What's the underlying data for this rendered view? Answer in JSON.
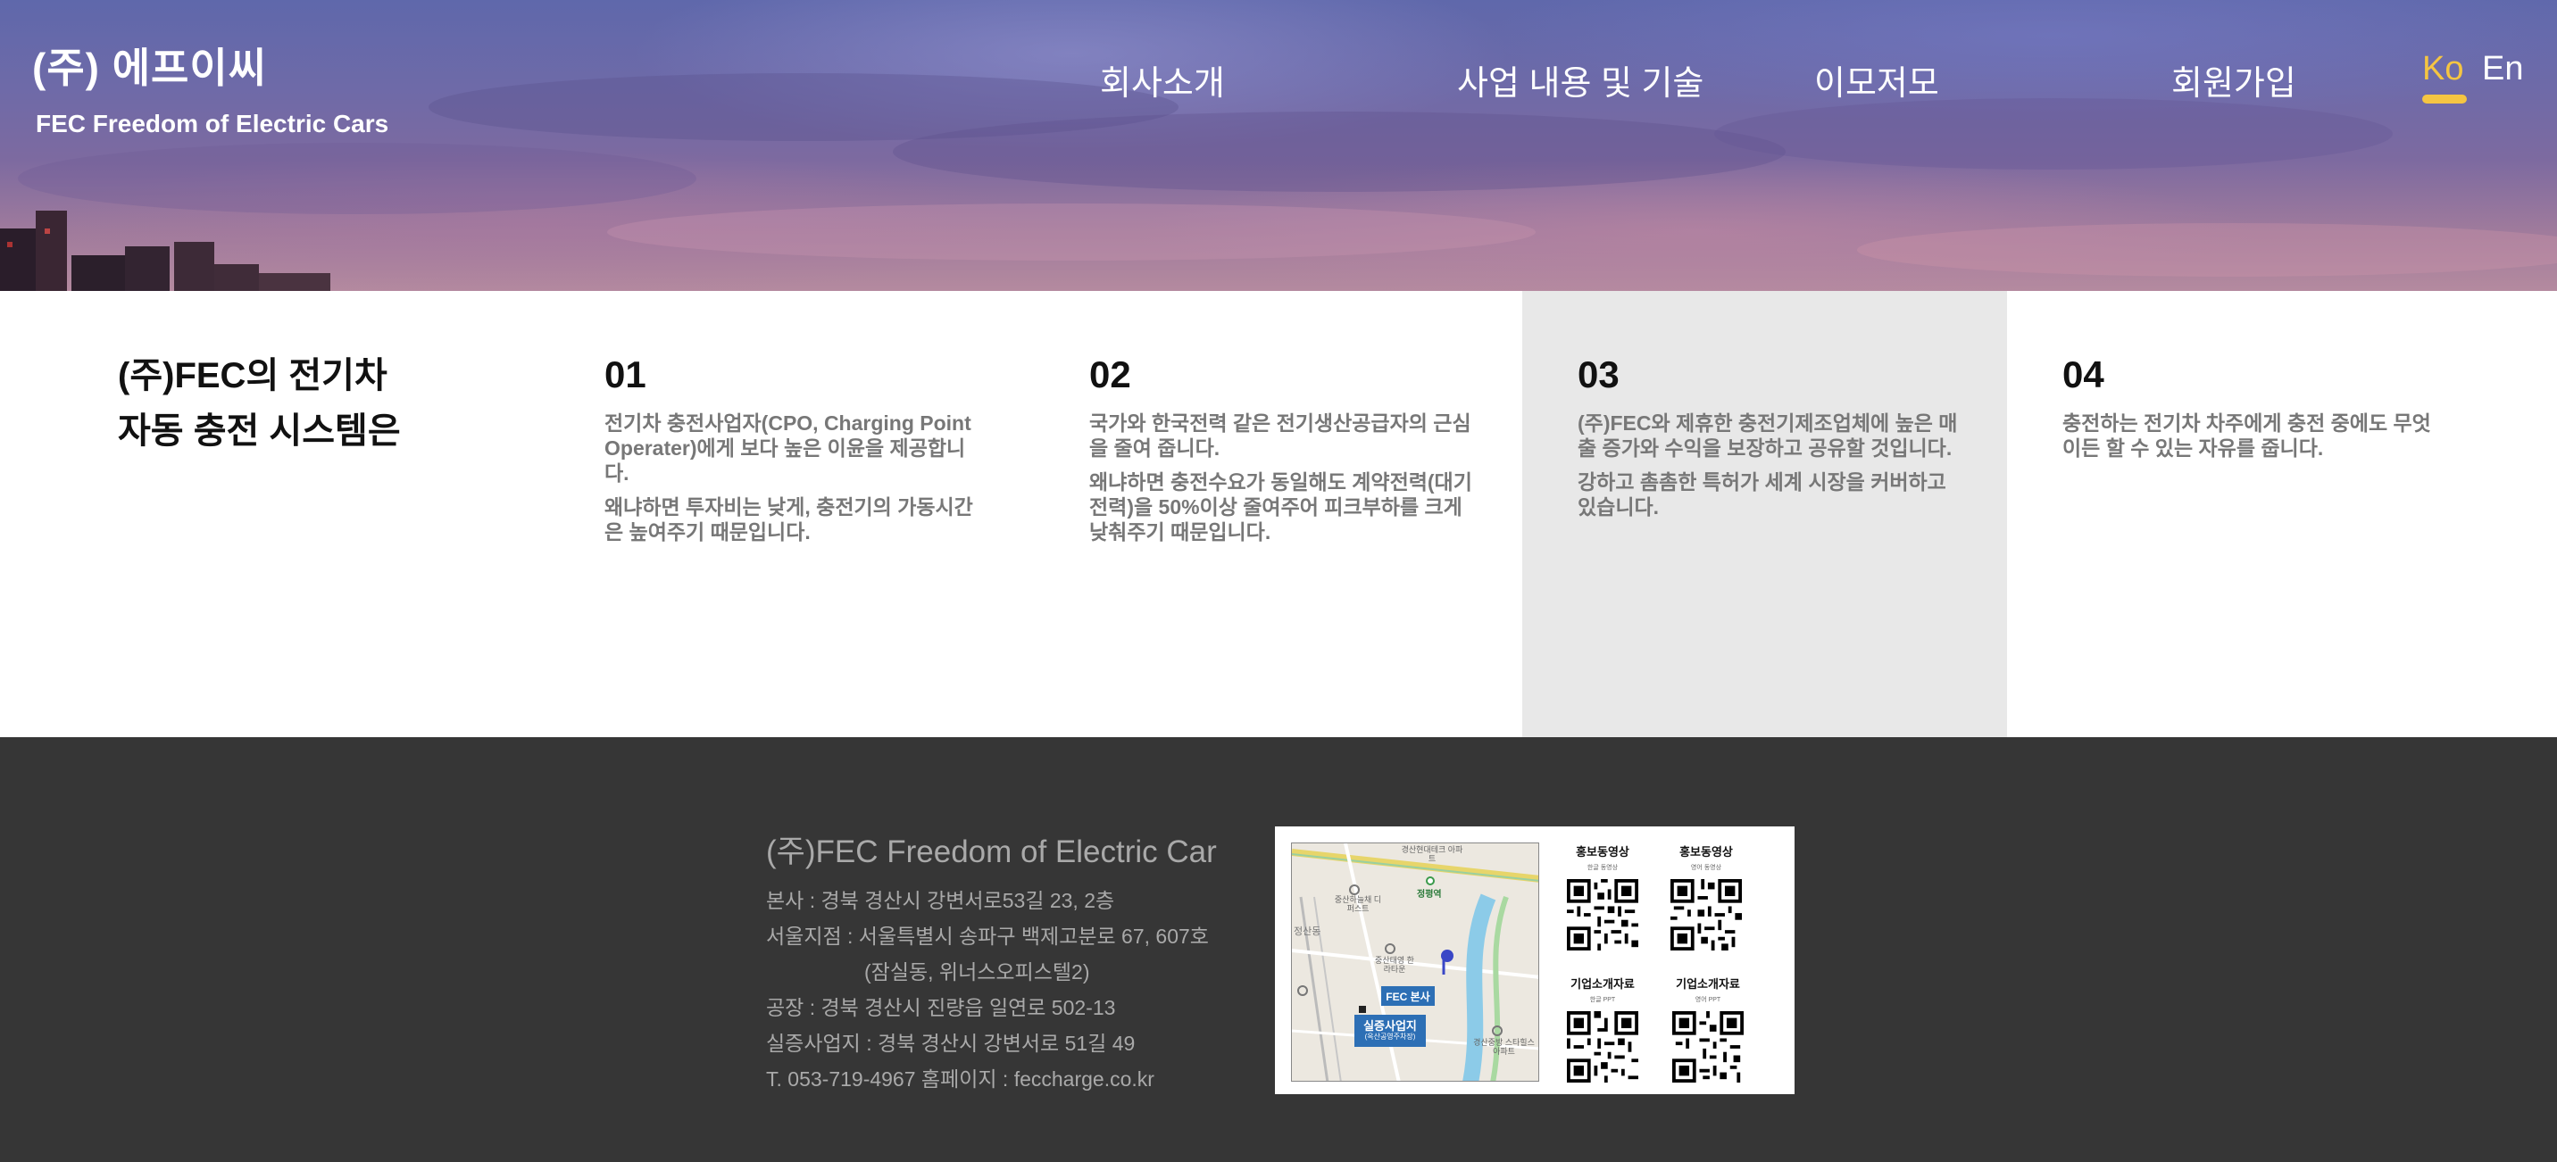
{
  "header": {
    "brand_title": "(주) 에프이씨",
    "brand_subtitle": "FEC Freedom of Electric Cars",
    "nav": [
      {
        "label": "회사소개"
      },
      {
        "label": "사업 내용 및 기술"
      },
      {
        "label": "이모저모"
      },
      {
        "label": "회원가입"
      }
    ],
    "lang": {
      "ko": "Ko",
      "en": "En",
      "active": "Ko"
    }
  },
  "features": {
    "title_line1": "(주)FEC의 전기차",
    "title_line2": "자동 충전 시스템은",
    "items": [
      {
        "num": "01",
        "p1": "전기차 충전사업자(CPO, Charging Point Operater)에게 보다 높은 이윤을 제공합니다.",
        "p2": "왜냐하면 투자비는 낮게, 충전기의 가동시간은 높여주기 때문입니다."
      },
      {
        "num": "02",
        "p1": "국가와 한국전력 같은 전기생산공급자의 근심을 줄여 줍니다.",
        "p2": "왜냐하면 충전수요가 동일해도 계약전력(대기전력)을 50%이상 줄여주어 피크부하를 크게 낮춰주기 때문입니다."
      },
      {
        "num": "03",
        "p1": "(주)FEC와 제휴한 충전기제조업체에 높은 매출 증가와 수익을 보장하고 공유할 것입니다.",
        "p2": "강하고 촘촘한 특허가 세계 시장을 커버하고 있습니다.",
        "highlighted": true
      },
      {
        "num": "04",
        "p1": "충전하는 전기차 차주에게 충전 중에도 무엇이든 할 수 있는 자유를 줍니다.",
        "p2": ""
      }
    ]
  },
  "footer": {
    "company_name": "(주)FEC Freedom of Electric Car",
    "hq": "본사 : 경북 경산시 강변서로53길 23, 2층",
    "seoul": "서울지점 : 서울특별시 송파구 백제고분로 67, 607호",
    "seoul_detail": "(잠실동, 위너스오피스텔2)",
    "factory": "공장 : 경북 경산시 진량읍 일연로 502-13",
    "demo_site": "실증사업지 : 경북 경산시 강변서로 51길 49",
    "contact": "T. 053-719-4967 홈페이지 : feccharge.co.kr",
    "map": {
      "pin_hq": "FEC 본사",
      "pin_demo": "실증사업지",
      "pin_demo_sub": "(옥산공영주차장)",
      "labels": [
        "경산현대테크 아파트",
        "정평역",
        "중산하늘채 디퍼스트",
        "중산태영 한라타운",
        "정산동",
        "경산중방 스타힐스아파트"
      ]
    },
    "qr_codes": [
      {
        "label": "홍보동영상",
        "sub": "한글 동영상"
      },
      {
        "label": "홍보동영상",
        "sub": "영어 동영상"
      },
      {
        "label": "기업소개자료",
        "sub": "한글 PPT"
      },
      {
        "label": "기업소개자료",
        "sub": "영어 PPT"
      }
    ]
  },
  "colors": {
    "accent": "#f5c542",
    "footer_bg": "#363636",
    "highlight_col": "#e8e8e8"
  }
}
